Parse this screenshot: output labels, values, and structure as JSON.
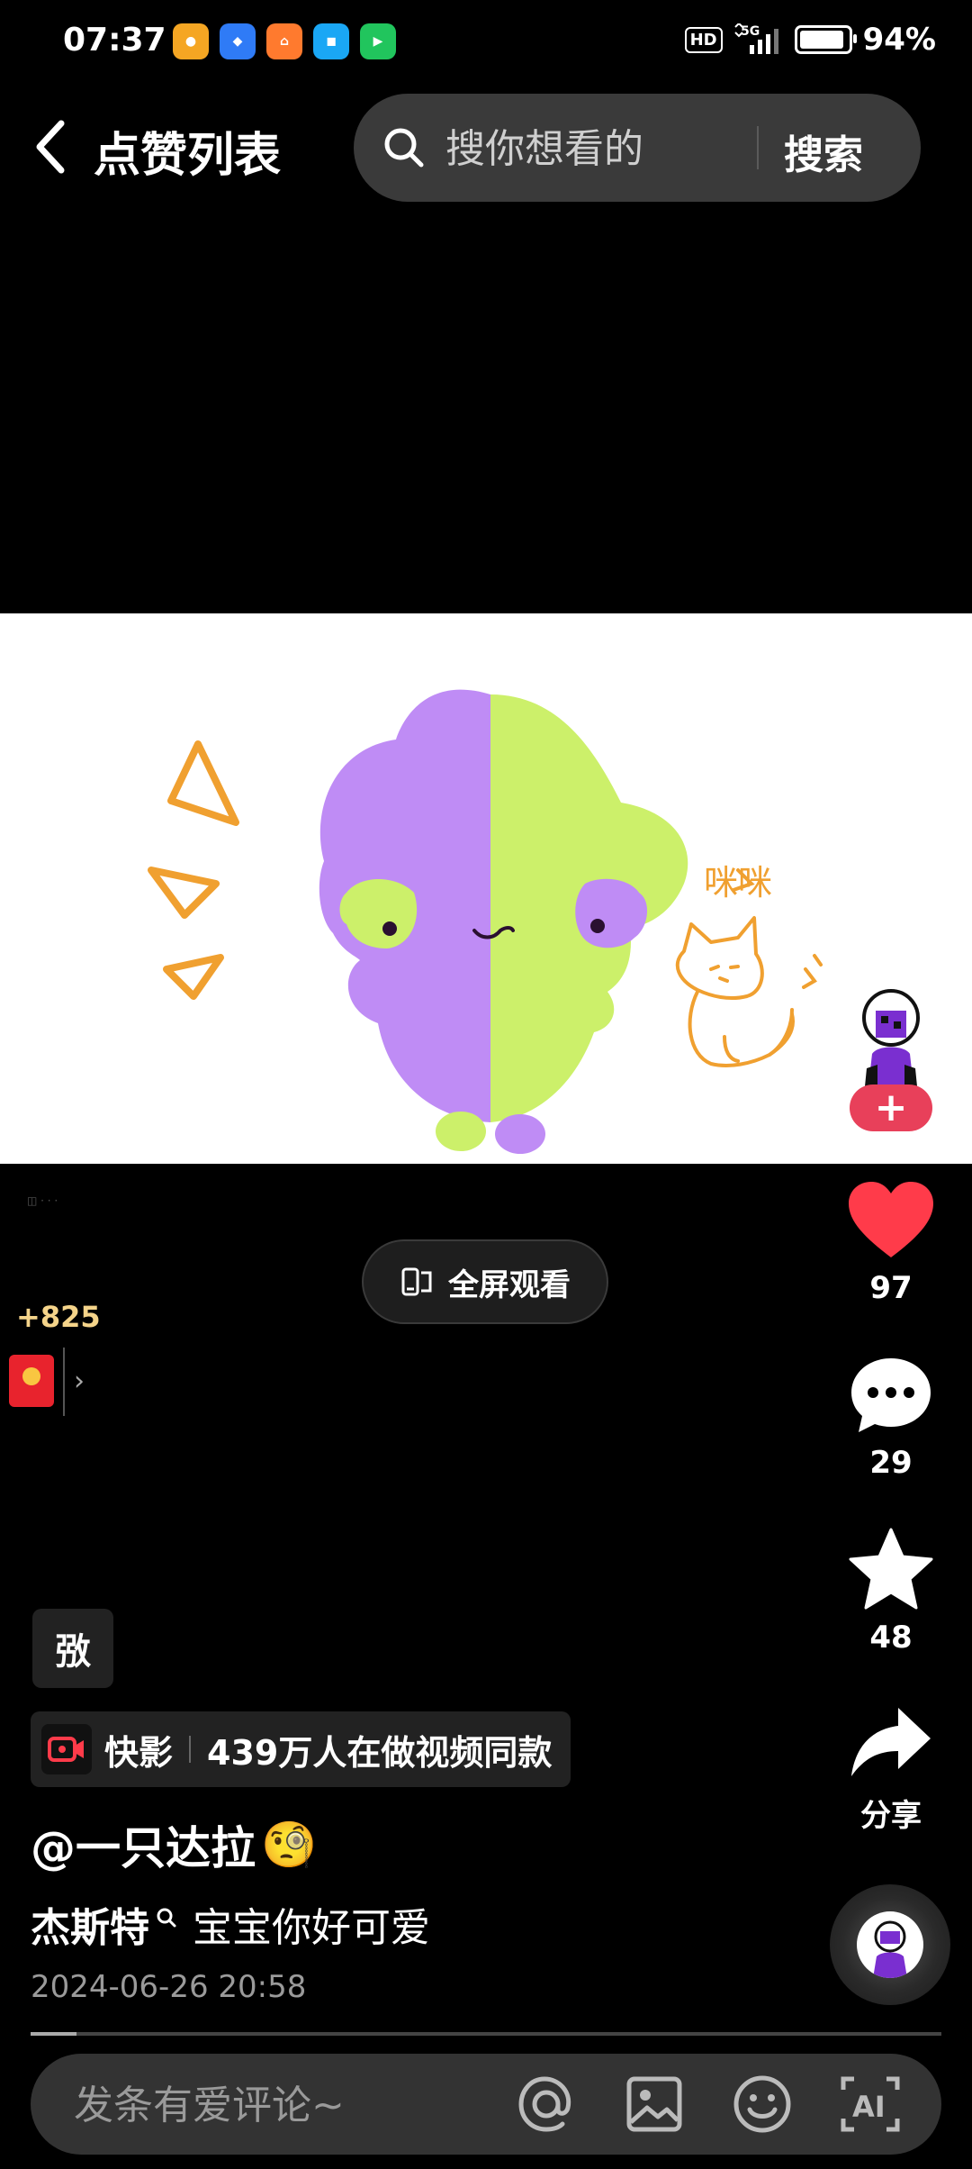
{
  "status_bar": {
    "time": "07:37",
    "hd": "HD",
    "network": "5G",
    "battery": "94%",
    "battery_level": 0.94
  },
  "header": {
    "title": "点赞列表",
    "search": {
      "placeholder": "搜你想看的",
      "button": "搜索"
    }
  },
  "video": {
    "annotation": "咪咪",
    "fullscreen_label": "全屏观看"
  },
  "reward": {
    "count": "+825",
    "chevron": "›"
  },
  "rail": {
    "follow": "+",
    "likes": "97",
    "comments": "29",
    "favorites": "48",
    "share": "分享"
  },
  "post": {
    "edit_chip": "㢸",
    "template": {
      "app": "快影",
      "text": "439万人在做视频同款"
    },
    "author": "@一只达拉",
    "author_emoji": "🧐",
    "caption_tag": "杰斯特",
    "caption_text": "宝宝你好可爱",
    "timestamp": "2024-06-26 20:58",
    "progress": 0.05
  },
  "comment_bar": {
    "placeholder": "发条有爱评论~"
  },
  "colors": {
    "like": "#ff3b4a",
    "follow": "#e8405a",
    "reward": "#f5d48a",
    "purple": "#bf8cf5",
    "lime": "#ccf06a",
    "sketch_orange": "#f0a030"
  }
}
